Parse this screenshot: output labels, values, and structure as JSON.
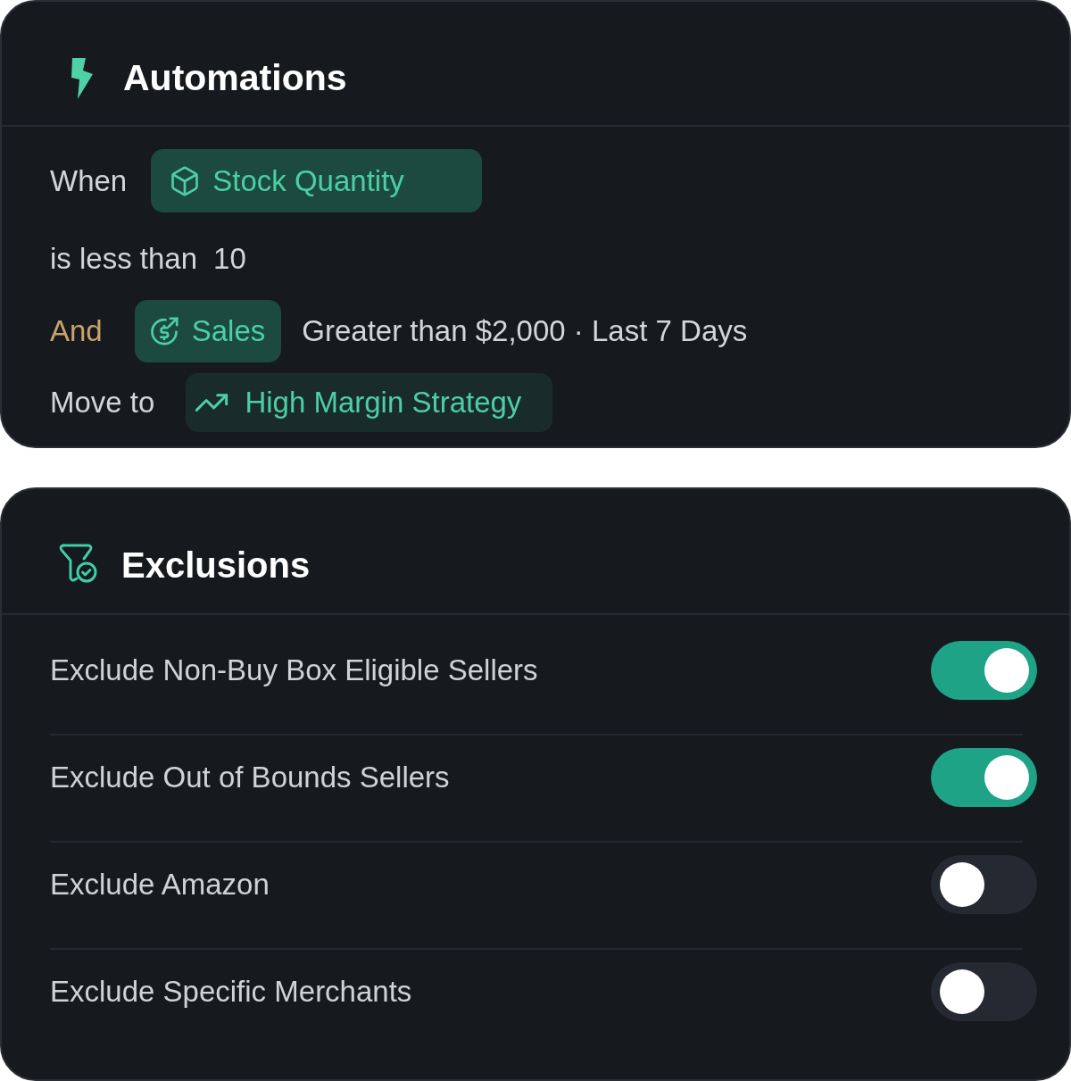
{
  "automations": {
    "title": "Automations",
    "rules": [
      {
        "kind": "trigger",
        "label": "When",
        "chip": "Stock Quantity"
      },
      {
        "kind": "condition",
        "operator": "is less than",
        "value": "10"
      },
      {
        "kind": "filter",
        "label": "And",
        "chip": "Sales",
        "detail": "Greater than $2,000 · Last 7 Days"
      },
      {
        "kind": "action",
        "label": "Move to",
        "chip": "High Margin Strategy"
      }
    ]
  },
  "exclusions": {
    "title": "Exclusions",
    "items": [
      {
        "label": "Exclude Non-Buy Box Eligible Sellers",
        "on": true
      },
      {
        "label": "Exclude Out of Bounds Sellers",
        "on": true
      },
      {
        "label": "Exclude Amazon",
        "on": false
      },
      {
        "label": "Exclude Specific Merchants",
        "on": false
      }
    ]
  }
}
